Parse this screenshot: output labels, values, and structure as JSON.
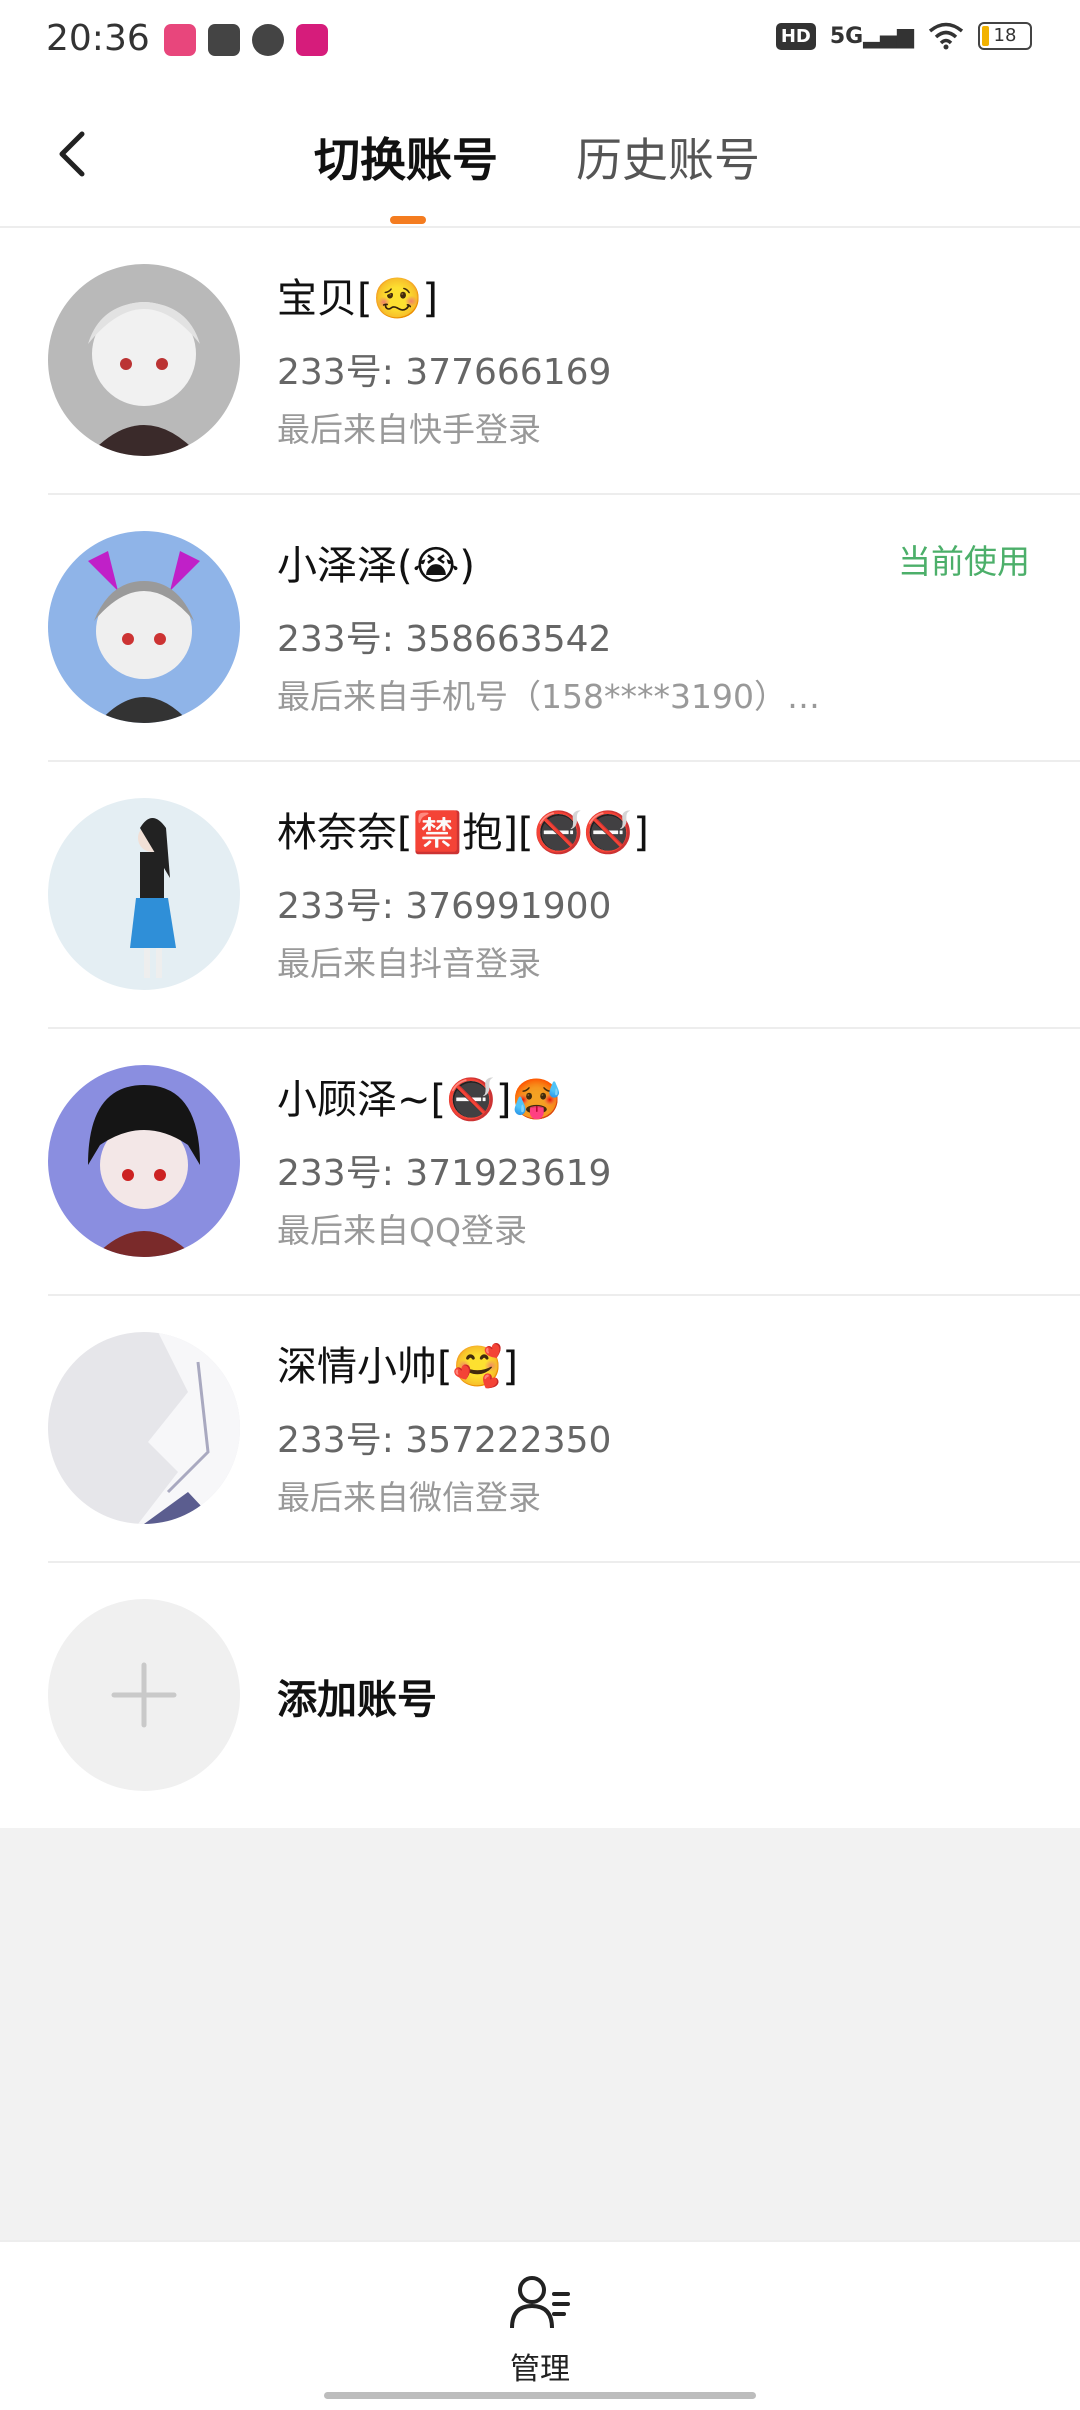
{
  "status_bar": {
    "time": "20:36",
    "network": "5G",
    "battery": "18"
  },
  "header": {
    "tab_current": "切换账号",
    "tab_history": "历史账号"
  },
  "accounts": [
    {
      "name": "宝贝[🥴]",
      "id": "233号: 377666169",
      "source": "最后来自快手登录",
      "current": false
    },
    {
      "name": "小泽泽(😭)",
      "id": "233号: 358663542",
      "source": "最后来自手机号（158****3190）…",
      "current": true
    },
    {
      "name": "林奈奈[🈲抱][🚭🚭]",
      "id": "233号: 376991900",
      "source": "最后来自抖音登录",
      "current": false
    },
    {
      "name": "小顾泽~[🚭]🥵",
      "id": "233号: 371923619",
      "source": "最后来自QQ登录",
      "current": false
    },
    {
      "name": "深情小帅[🥰]",
      "id": "233号: 357222350",
      "source": "最后来自微信登录",
      "current": false
    }
  ],
  "current_badge": "当前使用",
  "add_account_label": "添加账号",
  "bottom": {
    "manage_label": "管理"
  },
  "colors": {
    "accent": "#f47c20",
    "current": "#4caf6a"
  }
}
